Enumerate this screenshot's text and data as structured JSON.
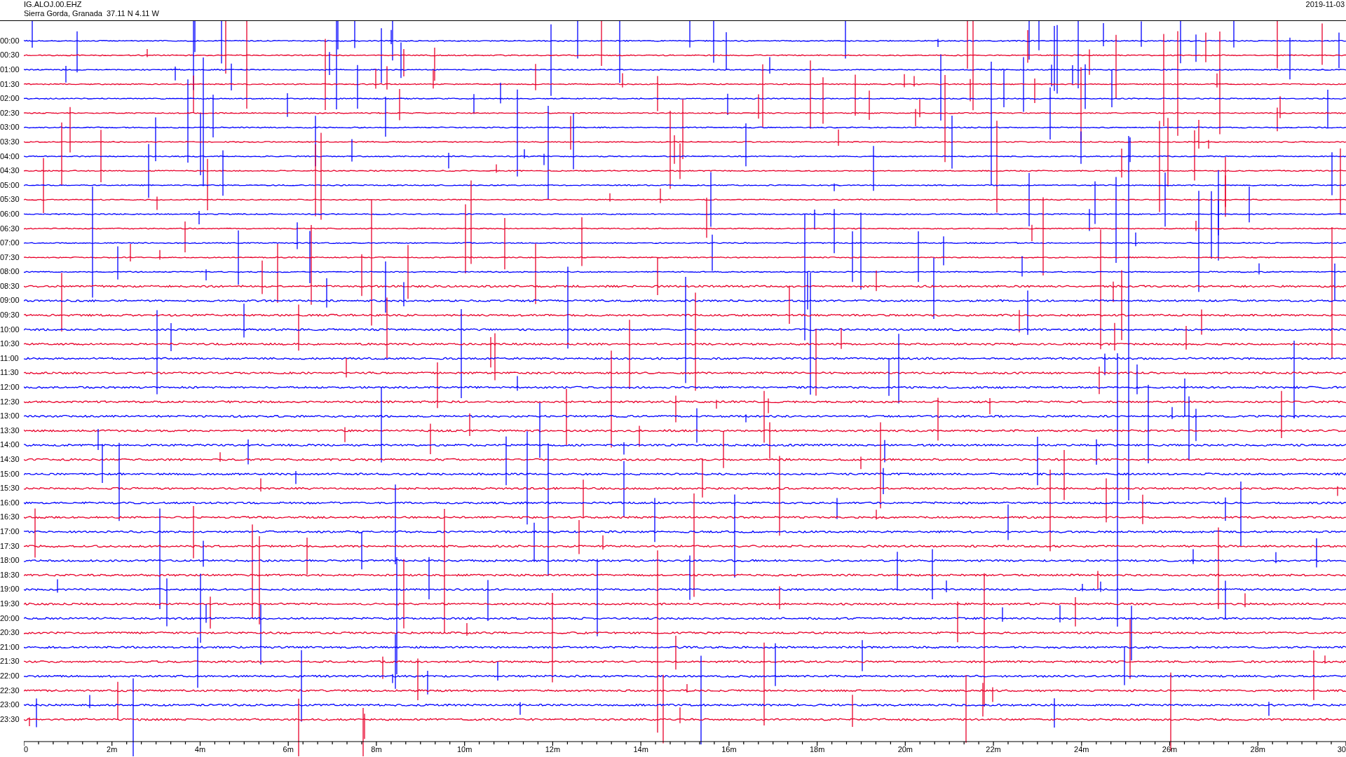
{
  "header": {
    "station": "IG.ALOJ.00.EHZ",
    "location": "Sierra Gorda, Granada  37.11 N 4.11 W",
    "date": "2019-11-03"
  },
  "rows": [
    {
      "label": "00:00",
      "color": "#0000ff"
    },
    {
      "label": "00:30",
      "color": "#e8002a"
    },
    {
      "label": "01:00",
      "color": "#0000ff"
    },
    {
      "label": "01:30",
      "color": "#e8002a"
    },
    {
      "label": "02:00",
      "color": "#0000ff"
    },
    {
      "label": "02:30",
      "color": "#e8002a"
    },
    {
      "label": "03:00",
      "color": "#0000ff"
    },
    {
      "label": "03:30",
      "color": "#e8002a"
    },
    {
      "label": "04:00",
      "color": "#0000ff"
    },
    {
      "label": "04:30",
      "color": "#e8002a"
    },
    {
      "label": "05:00",
      "color": "#0000ff"
    },
    {
      "label": "05:30",
      "color": "#e8002a"
    },
    {
      "label": "06:00",
      "color": "#0000ff"
    },
    {
      "label": "06:30",
      "color": "#e8002a"
    },
    {
      "label": "07:00",
      "color": "#0000ff"
    },
    {
      "label": "07:30",
      "color": "#e8002a"
    },
    {
      "label": "08:00",
      "color": "#0000ff"
    },
    {
      "label": "08:30",
      "color": "#e8002a"
    },
    {
      "label": "09:00",
      "color": "#0000ff"
    },
    {
      "label": "09:30",
      "color": "#e8002a"
    },
    {
      "label": "10:00",
      "color": "#0000ff"
    },
    {
      "label": "10:30",
      "color": "#e8002a"
    },
    {
      "label": "11:00",
      "color": "#0000ff"
    },
    {
      "label": "11:30",
      "color": "#e8002a"
    },
    {
      "label": "12:00",
      "color": "#0000ff"
    },
    {
      "label": "12:30",
      "color": "#e8002a"
    },
    {
      "label": "13:00",
      "color": "#0000ff"
    },
    {
      "label": "13:30",
      "color": "#e8002a"
    },
    {
      "label": "14:00",
      "color": "#0000ff"
    },
    {
      "label": "14:30",
      "color": "#e8002a"
    },
    {
      "label": "15:00",
      "color": "#0000ff"
    },
    {
      "label": "15:30",
      "color": "#e8002a"
    },
    {
      "label": "16:00",
      "color": "#0000ff"
    },
    {
      "label": "16:30",
      "color": "#e8002a"
    },
    {
      "label": "17:00",
      "color": "#0000ff"
    },
    {
      "label": "17:30",
      "color": "#e8002a"
    },
    {
      "label": "18:00",
      "color": "#0000ff"
    },
    {
      "label": "18:30",
      "color": "#e8002a"
    },
    {
      "label": "19:00",
      "color": "#0000ff"
    },
    {
      "label": "19:30",
      "color": "#e8002a"
    },
    {
      "label": "20:00",
      "color": "#0000ff"
    },
    {
      "label": "20:30",
      "color": "#e8002a"
    },
    {
      "label": "21:00",
      "color": "#0000ff"
    },
    {
      "label": "21:30",
      "color": "#e8002a"
    },
    {
      "label": "22:00",
      "color": "#0000ff"
    },
    {
      "label": "22:30",
      "color": "#e8002a"
    },
    {
      "label": "23:00",
      "color": "#0000ff"
    },
    {
      "label": "23:30",
      "color": "#e8002a"
    }
  ],
  "x_axis": {
    "ticks": [
      "0",
      "2m",
      "4m",
      "6m",
      "8m",
      "10m",
      "12m",
      "14m",
      "16m",
      "18m",
      "20m",
      "22m",
      "24m",
      "26m",
      "28m",
      "30"
    ]
  }
}
